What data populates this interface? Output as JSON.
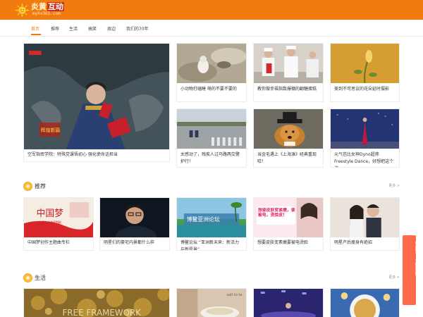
{
  "site": {
    "logo_cn": "炎黄",
    "logo_box": "互动",
    "logo_url": "myhv365.com"
  },
  "nav": {
    "items": [
      "首页",
      "推荐",
      "生活",
      "搞笑",
      "周边",
      "我们的70年"
    ]
  },
  "featured": [
    {
      "caption": "空军指挥学院：特殊党课悟初心 强化使命话担当",
      "thumb_text": "辉煌新篇"
    },
    {
      "caption": "小动物打磕睡 萌的不要不要的"
    },
    {
      "caption": "教你做幸福指数爆棚的翻糖蛋糕"
    },
    {
      "caption": "美到不可思议的花朵延时摄影"
    },
    {
      "caption": "太感动了，残疾人过马路两交警护行！"
    },
    {
      "caption": "当金毛遇上《上海滩》经典重现哈！"
    },
    {
      "caption": "元气芭比女神Dyno超帅Freestyle Dance，好想把这个洋"
    }
  ],
  "sections": [
    {
      "title": "推荐",
      "more": "更多 >",
      "items": [
        {
          "caption": "中国梦创作主题曲专栏",
          "thumb_text": "中国梦",
          "thumb_sub": "主题曲创作星期剧"
        },
        {
          "caption": "明星们的豪宅内景都什么样"
        },
        {
          "caption": "博鳌论坛 “亚洲新未来：新活力与新愿景”",
          "thumb_text": "博鳌亚洲论坛"
        },
        {
          "caption": "想要皮肤变素嫩要被电烫脸",
          "thumb_text": "想要皮肤变紧嫩，要被电，烫脸皮！"
        },
        {
          "caption": "明星产后瘦身有绝招"
        }
      ]
    },
    {
      "title": "生活",
      "more": "更多 >",
      "items": [
        {
          "thumb_text": "FREE FRAMEWORK"
        },
        {
          "thumb_text": "salt to ta"
        },
        {},
        {}
      ]
    }
  ],
  "side_tab": {
    "label": "中国梦·主题展播"
  }
}
